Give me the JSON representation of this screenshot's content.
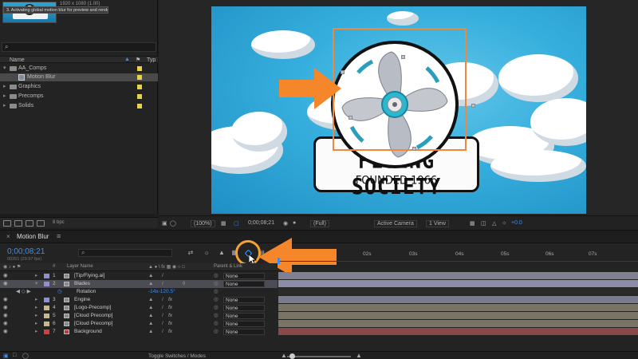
{
  "project": {
    "info_line": "1920 x 1080 (1.00)",
    "tooltip": "3. Activating global motion blur for preview and render",
    "header_name": "Name",
    "header_type": "Typ",
    "items": [
      {
        "label": "AA_Comps",
        "kind": "folder",
        "open": true,
        "indent": 0
      },
      {
        "label": "Motion Blur",
        "kind": "comp",
        "indent": 1,
        "selected": true
      },
      {
        "label": "Graphics",
        "kind": "folder",
        "indent": 0
      },
      {
        "label": "Precomps",
        "kind": "folder",
        "indent": 0
      },
      {
        "label": "Solids",
        "kind": "folder",
        "indent": 0
      }
    ],
    "bpc": "8 bpc",
    "label_color": "#e8d24a"
  },
  "canvas": {
    "card_title": "FLYING SOCIETY",
    "card_subtitle": "FOUNDED 1966",
    "accent": "#f0883a",
    "sky": "#35aedd"
  },
  "viewer_bar": {
    "zoom": "(100%)",
    "timecode": "0;00;08;21",
    "resolution": "(Full)",
    "camera": "Active Camera",
    "views": "1 View",
    "exposure": "+0.0"
  },
  "timeline": {
    "tab": "Motion Blur",
    "timecode": "0;00;08;21",
    "frames": "00261 (29.97 fps)",
    "ruler": [
      "02s",
      "03s",
      "04s",
      "05s",
      "06s",
      "07s"
    ],
    "header_num": "#",
    "header_layer": "Layer Name",
    "header_parent": "Parent & Link",
    "layers": [
      {
        "num": "1",
        "name": "[Tip/Flying.ai]",
        "color": "#8f8fd8",
        "parent": "None",
        "fx": false,
        "bar": "#8a8a9a"
      },
      {
        "num": "2",
        "name": "Blades",
        "color": "#8f8fd8",
        "parent": "None",
        "fx": false,
        "bar": "#8a8aa6",
        "selected": true
      },
      {
        "num": "",
        "name": "Rotation",
        "sub": true,
        "value": "-14x-120.5°"
      },
      {
        "num": "3",
        "name": "Engine",
        "color": "#8f8fd8",
        "parent": "None",
        "fx": true,
        "bar": "#7d7d8f"
      },
      {
        "num": "4",
        "name": "[Logo-Precomp]",
        "color": "#c9b98a",
        "parent": "None",
        "fx": true,
        "bar": "#7c7566"
      },
      {
        "num": "5",
        "name": "[Cloud Precomp]",
        "color": "#c9b98a",
        "parent": "None",
        "fx": true,
        "bar": "#7c7566"
      },
      {
        "num": "6",
        "name": "[Cloud Precomp]",
        "color": "#c9b98a",
        "parent": "None",
        "fx": true,
        "bar": "#7c7566"
      },
      {
        "num": "7",
        "name": "Background",
        "color": "#d04040",
        "parent": "None",
        "fx": true,
        "bar": "#8a4848"
      }
    ],
    "toggle_label": "Toggle Switches / Modes"
  }
}
